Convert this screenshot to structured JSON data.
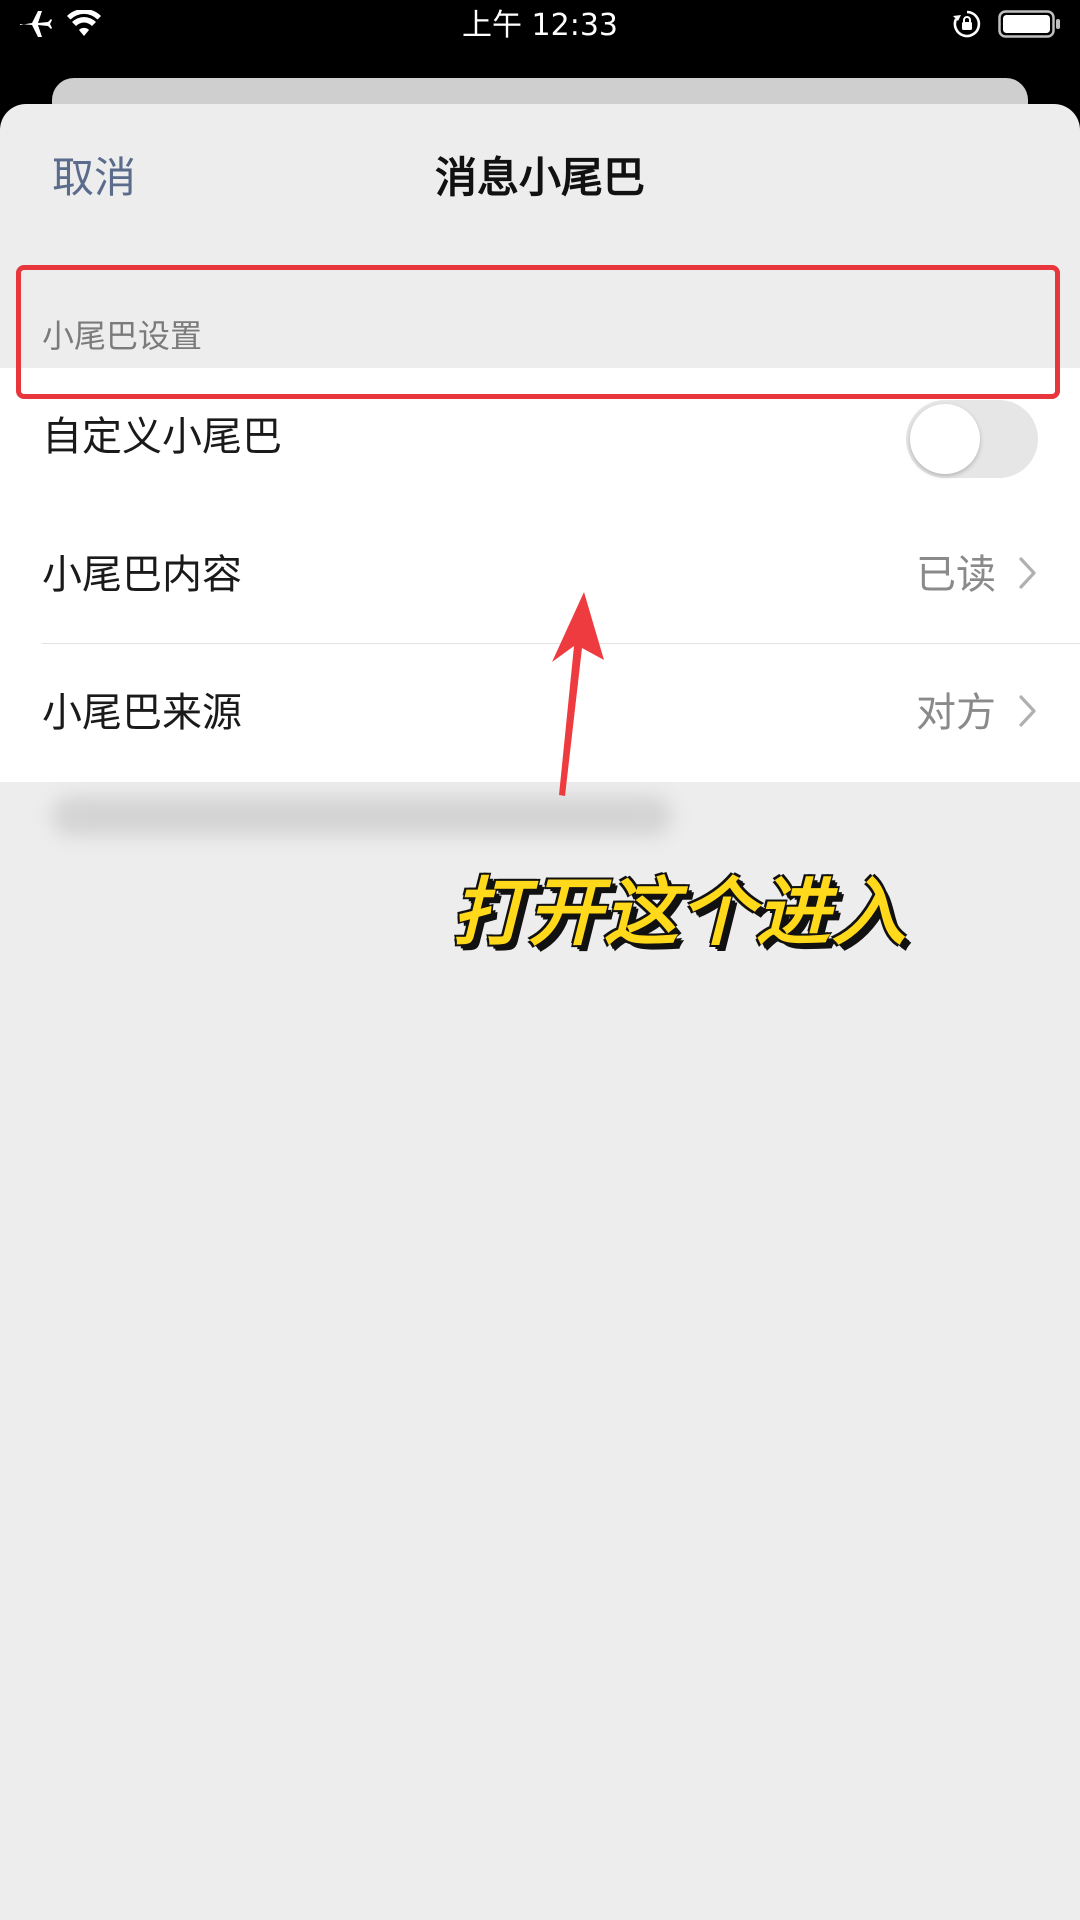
{
  "status_bar": {
    "time": "上午 12:33",
    "icons": [
      "airplane-icon",
      "wifi-icon",
      "rotation-lock-icon",
      "battery-icon"
    ]
  },
  "nav": {
    "cancel_label": "取消",
    "title": "消息小尾巴"
  },
  "section": {
    "header": "小尾巴设置"
  },
  "rows": [
    {
      "label": "自定义小尾巴",
      "type": "toggle",
      "toggle_on": false
    },
    {
      "label": "小尾巴内容",
      "type": "detail",
      "value": "已读"
    },
    {
      "label": "小尾巴来源",
      "type": "detail",
      "value": "对方"
    }
  ],
  "annotation": {
    "caption": "打开这个进入",
    "highlight_color": "#e8373c",
    "caption_color": "#ffd91a"
  },
  "colors": {
    "link": "#5a6b8c",
    "background": "#ededed"
  }
}
